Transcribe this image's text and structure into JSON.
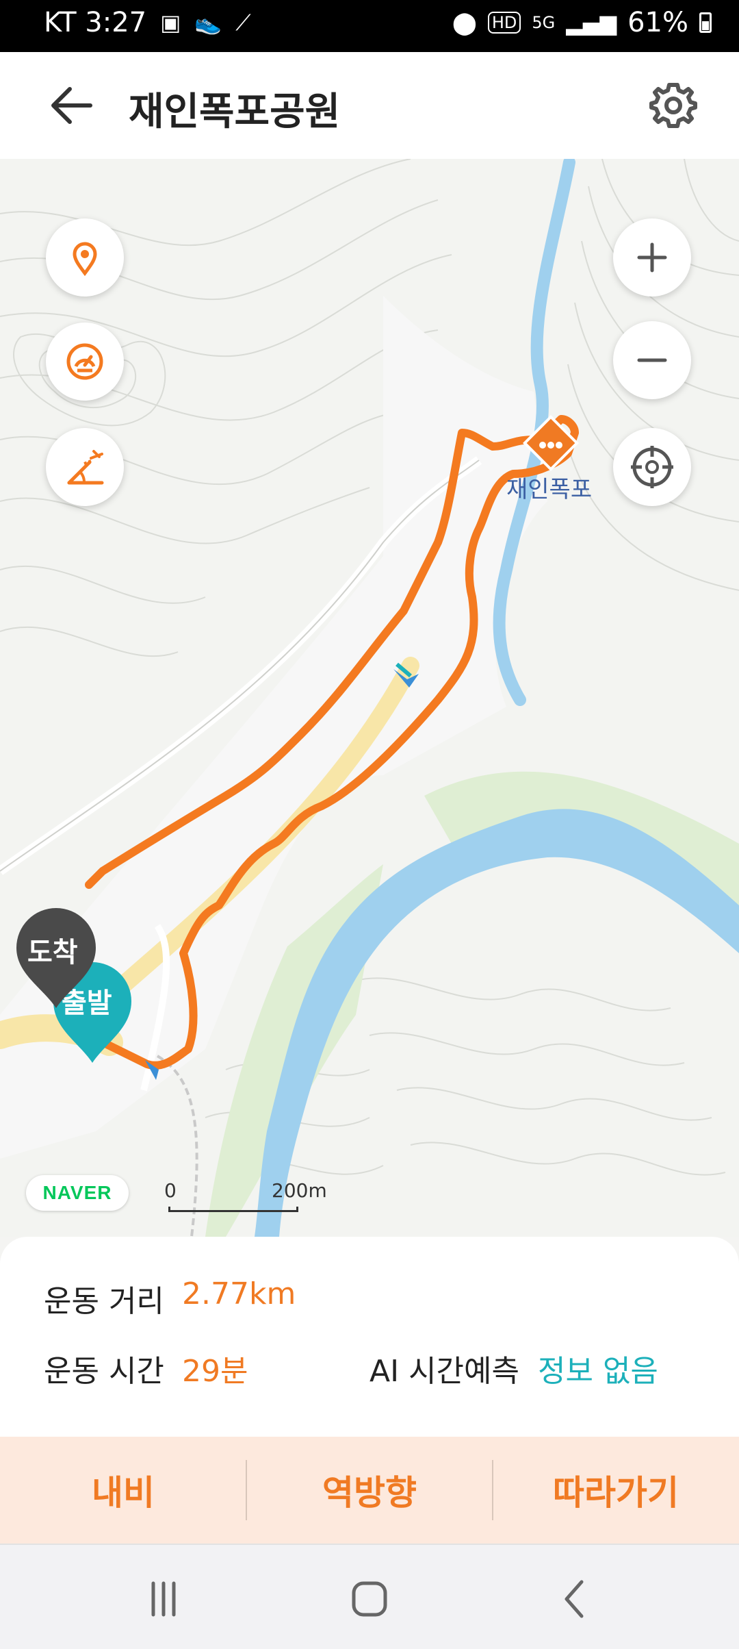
{
  "status_bar": {
    "carrier_time": "KT 3:27",
    "left_icons": [
      "image-icon",
      "shoe-icon",
      "sync-icon"
    ],
    "right_icons": [
      "location-icon",
      "hd-icon",
      "5g-icon",
      "signal-icon"
    ],
    "battery": "61%"
  },
  "app_bar": {
    "title": "재인폭포공원"
  },
  "map": {
    "place_name": "재인폭포",
    "arrive_label": "도착",
    "start_label": "출발",
    "naver_logo": "NAVER",
    "scale_start": "0",
    "scale_end": "200m",
    "colors": {
      "route": "#f47a20",
      "river": "#9fd0ee",
      "arrive_marker": "#4a4a4a",
      "start_marker": "#1cb0ba"
    }
  },
  "info": {
    "distance_label": "운동 거리",
    "distance_value": "2.77km",
    "time_label": "운동 시간",
    "time_value": "29분",
    "ai_label": "AI 시간예측",
    "ai_value": "정보 없음"
  },
  "actions": {
    "nav_label": "내비",
    "reverse_label": "역방향",
    "follow_label": "따라가기"
  }
}
